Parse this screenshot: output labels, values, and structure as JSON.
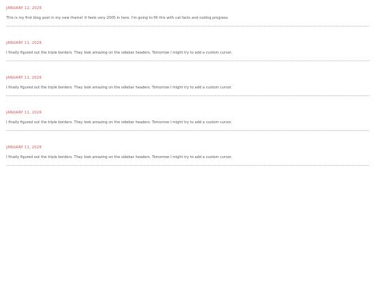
{
  "posts": [
    {
      "date": "JANUARY 12, 2026",
      "body": "This is my first blog post in my new iframe! It feels very 2005 in here. I'm going to fill this with cat facts and coding progress."
    },
    {
      "date": "JANUARY 11, 2026",
      "body": "I finally figured out the triple borders. They look amazing on the sidebar headers. Tomorrow I might try to add a custom cursor."
    },
    {
      "date": "JANUARY 11, 2026",
      "body": "I finally figured out the triple borders. They look amazing on the sidebar headers. Tomorrow I might try to add a custom cursor."
    },
    {
      "date": "JANUARY 11, 2026",
      "body": "I finally figured out the triple borders. They look amazing on the sidebar headers. Tomorrow I might try to add a custom cursor."
    },
    {
      "date": "JANUARY 11, 2026",
      "body": "I finally figured out the triple borders. They look amazing on the sidebar headers. Tomorrow I might try to add a custom cursor."
    }
  ]
}
